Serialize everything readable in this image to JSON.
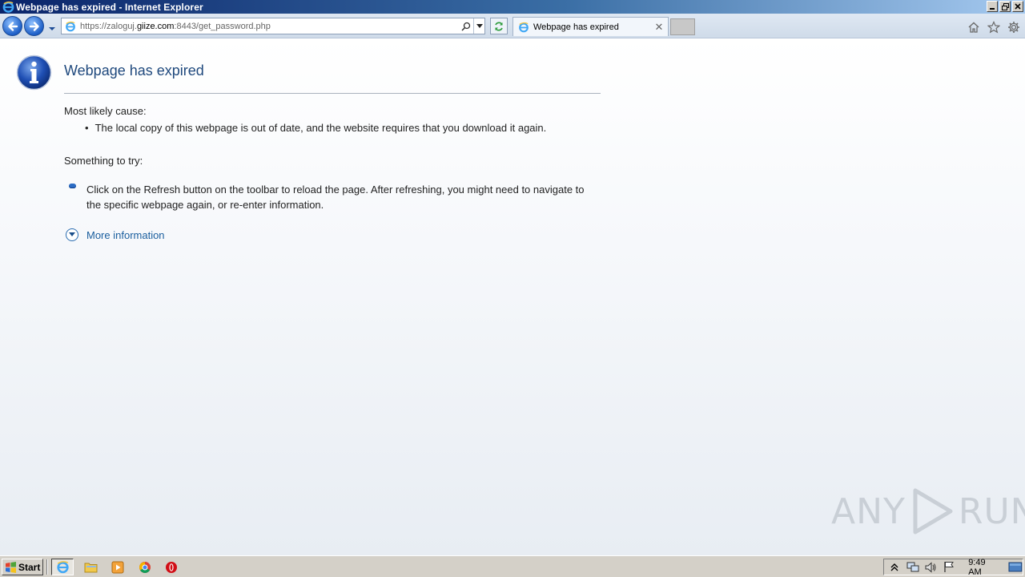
{
  "window": {
    "title": "Webpage has expired - Internet Explorer"
  },
  "navbar": {
    "url_scheme_path_prefix": "https://zaloguj.",
    "url_host": "giize.com",
    "url_suffix": ":8443/get_password.php",
    "tab_title": "Webpage has expired"
  },
  "page": {
    "title": "Webpage has expired",
    "cause_label": "Most likely cause:",
    "cause_item": "The local copy of this webpage is out of date, and the website requires that you download it again.",
    "try_label": "Something to try:",
    "try_item": "Click on the Refresh button on the toolbar to reload the page. After refreshing, you might need to navigate to the specific webpage again, or re-enter information.",
    "more_info": "More information"
  },
  "watermark": {
    "left": "ANY",
    "right": "RUN"
  },
  "taskbar": {
    "start_label": "Start",
    "clock": "9:49 AM"
  },
  "colors": {
    "title_color": "#1f497d",
    "link_color": "#1a5e9e",
    "accent": "#2b6cc4"
  }
}
